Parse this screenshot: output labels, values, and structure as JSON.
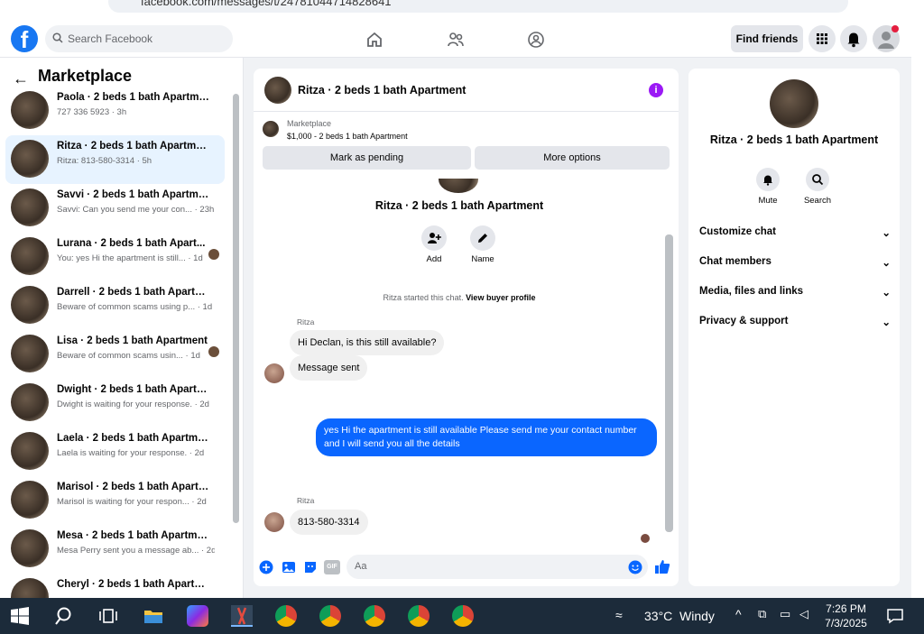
{
  "browser": {
    "url": "facebook.com/messages/t/24781044714828641"
  },
  "header": {
    "logo": "f",
    "search_placeholder": "Search Facebook",
    "find_friends": "Find friends"
  },
  "left": {
    "title": "Marketplace",
    "conversations": [
      {
        "title": "Paola · 2 beds 1 bath Apartment",
        "sub": "727 336 5923 · 3h"
      },
      {
        "title": "Ritza · 2 beds 1 bath Apartment",
        "sub": "Ritza: 813-580-3314 · 5h"
      },
      {
        "title": "Savvi · 2 beds 1 bath Apartment",
        "sub": "Savvi: Can you send me your con... · 23h"
      },
      {
        "title": "Lurana · 2 beds 1 bath Apart...",
        "sub": "You: yes Hi the apartment is still... · 1d"
      },
      {
        "title": "Darrell · 2 beds 1 bath Apartment",
        "sub": "Beware of common scams using p... · 1d"
      },
      {
        "title": "Lisa · 2 beds 1 bath Apartment",
        "sub": "Beware of common scams usin... · 1d"
      },
      {
        "title": "Dwight · 2 beds 1 bath Apartme...",
        "sub": "Dwight is waiting for your response. · 2d"
      },
      {
        "title": "Laela · 2 beds 1 bath Apartment",
        "sub": "Laela is waiting for your response. · 2d"
      },
      {
        "title": "Marisol · 2 beds 1 bath Apartm...",
        "sub": "Marisol is waiting for your respon... · 2d"
      },
      {
        "title": "Mesa · 2 beds 1 bath Apartment",
        "sub": "Mesa Perry sent you a message ab... · 2d"
      },
      {
        "title": "Cheryl · 2 beds 1 bath Apartment",
        "sub": ""
      }
    ]
  },
  "chat": {
    "title": "Ritza · 2 beds 1 bath Apartment",
    "marketplace_label": "Marketplace",
    "listing": "$1,000 - 2 beds 1 bath Apartment",
    "mark_pending": "Mark as pending",
    "more_options": "More options",
    "profile_title": "Ritza · 2 beds 1 bath Apartment",
    "add_label": "Add",
    "name_label": "Name",
    "system_text": "Ritza started this chat.",
    "system_link": "View buyer profile",
    "sender1": "Ritza",
    "msg1": "Hi Declan, is this still available?",
    "msg2": "Message sent",
    "mine": "yes Hi the apartment is still available Please send me your contact number and I will send you all the details",
    "sender2": "Ritza",
    "msg3": "813-580-3314",
    "compose_placeholder": "Aa",
    "gif": "GIF"
  },
  "right": {
    "title": "Ritza · 2 beds 1 bath Apartment",
    "mute": "Mute",
    "search": "Search",
    "sections": [
      "Customize chat",
      "Chat members",
      "Media, files and links",
      "Privacy & support"
    ]
  },
  "taskbar": {
    "temp": "33°C",
    "weather": "Windy",
    "time": "7:26 PM",
    "date": "7/3/2025"
  },
  "colors": {
    "brand": "#1877f2",
    "bubble_mine": "#0a66ff",
    "info": "#9b19f5"
  }
}
